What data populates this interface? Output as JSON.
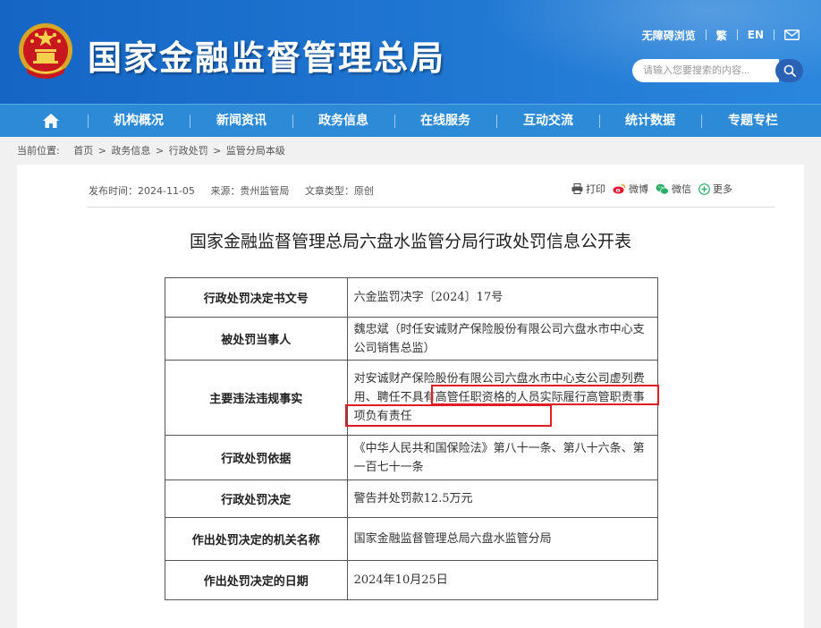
{
  "header": {
    "site_title": "国家金融监督管理总局",
    "top_links": [
      "无障碍浏览",
      "繁",
      "EN"
    ],
    "search_placeholder": "请输入您要搜索的内容..."
  },
  "nav": {
    "items": [
      "机构概况",
      "新闻资讯",
      "政务信息",
      "在线服务",
      "互动交流",
      "统计数据",
      "专题专栏"
    ]
  },
  "breadcrumb": {
    "label": "当前位置:",
    "path": [
      "首页",
      "政务信息",
      "行政处罚",
      "监管分局本级"
    ],
    "separator": ">"
  },
  "article": {
    "publish_date": "发布时间：2024-11-05",
    "source": "来源：贵州监管局",
    "type": "文章类型：原创",
    "share": [
      "打印",
      "微博",
      "微信",
      "更多"
    ],
    "title": "国家金融监督管理总局六盘水监管分局行政处罚信息公开表"
  },
  "table": {
    "rows": [
      {
        "key": "行政处罚决定书文号",
        "value": "六金监罚决字〔2024〕17号"
      },
      {
        "key": "被处罚当事人",
        "value": "魏忠斌（时任安诚财产保险股份有限公司六盘水市中心支公司销售总监）"
      },
      {
        "key": "主要违法违规事实",
        "value": "对安诚财产保险股份有限公司六盘水市中心支公司虚列费用、聘任不具有高管任职资格的人员实际履行高管职责事项负有责任"
      },
      {
        "key": "行政处罚依据",
        "value": "《中华人民共和国保险法》第八十一条、第八十六条、第一百七十一条"
      },
      {
        "key": "行政处罚决定",
        "value": "警告并处罚款12.5万元"
      },
      {
        "key": "作出处罚决定的机关名称",
        "value": "国家金融监督管理总局六盘水监管分局"
      },
      {
        "key": "作出处罚决定的日期",
        "value": "2024年10月25日"
      }
    ]
  },
  "colors": {
    "header_blue": "#1e74d0",
    "nav_blue": "#2d8ad6",
    "highlight_red": "#e21c24"
  }
}
